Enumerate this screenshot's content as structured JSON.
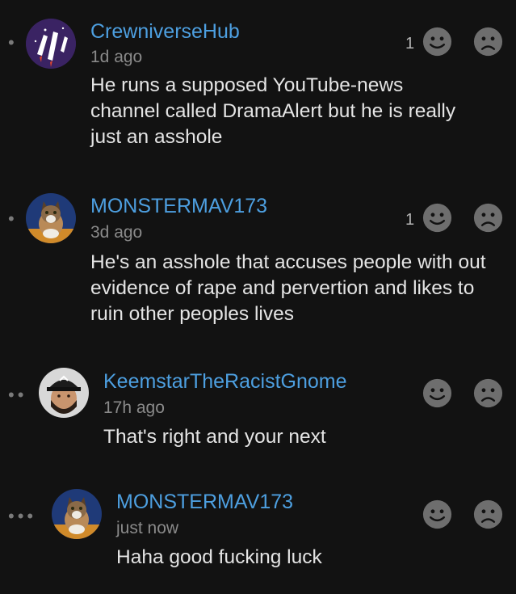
{
  "comments": [
    {
      "username": "CrewniverseHub",
      "time": "1d ago",
      "text": "He runs a supposed YouTube-news channel called DramaAlert but he is really just an asshole",
      "likes": "1",
      "avatar": "rocket-avatar"
    },
    {
      "username": "MONSTERMAV173",
      "time": "3d ago",
      "text": "He's an asshole that accuses people with out evidence of rape and pervertion and likes to ruin other peoples lives",
      "likes": "1",
      "avatar": "cat-avatar"
    },
    {
      "username": "KeemstarTheRacistGnome",
      "time": "17h ago",
      "text": "That's right and your next",
      "likes": "",
      "avatar": "man-with-cap-avatar"
    },
    {
      "username": "MONSTERMAV173",
      "time": "just now",
      "text": "Haha good fucking luck",
      "likes": "",
      "avatar": "cat-avatar"
    }
  ],
  "colors": {
    "background": "#121212",
    "username": "#4d9fe0",
    "timestamp": "#8a8a8a",
    "text": "#e4e4e4",
    "face_icon": "#6e6e6e"
  },
  "icons": {
    "like": "smiley-face-icon",
    "dislike": "sad-face-icon"
  }
}
